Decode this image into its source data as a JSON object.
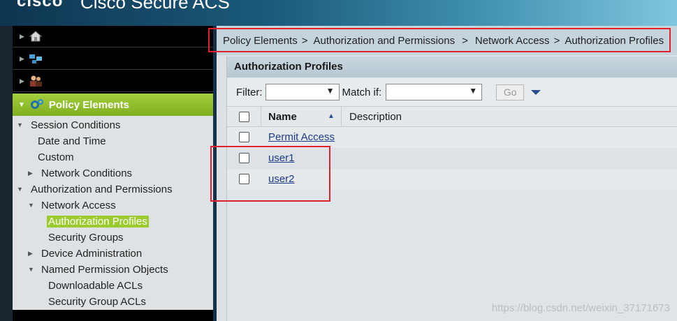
{
  "header": {
    "brand": "cisco",
    "title": "Cisco Secure ACS"
  },
  "sidebar": {
    "drawers": [
      {
        "icon": "house-icon"
      },
      {
        "icon": "network-devices-icon"
      },
      {
        "icon": "users-icon"
      }
    ],
    "active_drawer": {
      "label": "Policy Elements",
      "icon": "policy-elements-icon"
    },
    "tree": {
      "session_conditions": "Session Conditions",
      "date_and_time": "Date and Time",
      "custom": "Custom",
      "network_conditions": "Network Conditions",
      "authz_permissions": "Authorization and Permissions",
      "network_access": "Network Access",
      "authz_profiles": "Authorization Profiles",
      "security_groups": "Security Groups",
      "device_admin": "Device Administration",
      "named_permission_objects": "Named Permission Objects",
      "downloadable_acls": "Downloadable ACLs",
      "security_group_acls": "Security Group ACLs"
    }
  },
  "breadcrumb": {
    "items": [
      "Policy Elements",
      "Authorization and Permissions",
      "Network Access",
      "Authorization Profiles"
    ],
    "separator": ">"
  },
  "panel": {
    "title": "Authorization Profiles",
    "filter_label": "Filter:",
    "match_label": "Match if:",
    "go_label": "Go",
    "columns": {
      "name": "Name",
      "description": "Description"
    },
    "rows": [
      {
        "name": "Permit Access",
        "description": ""
      },
      {
        "name": "user1",
        "description": ""
      },
      {
        "name": "user2",
        "description": ""
      }
    ]
  },
  "watermark": "https://blog.csdn.net/weixin_37171673",
  "colors": {
    "accent_green": "#9bcb2e",
    "highlight_red": "#e0202a",
    "link": "#1a3a8a"
  }
}
